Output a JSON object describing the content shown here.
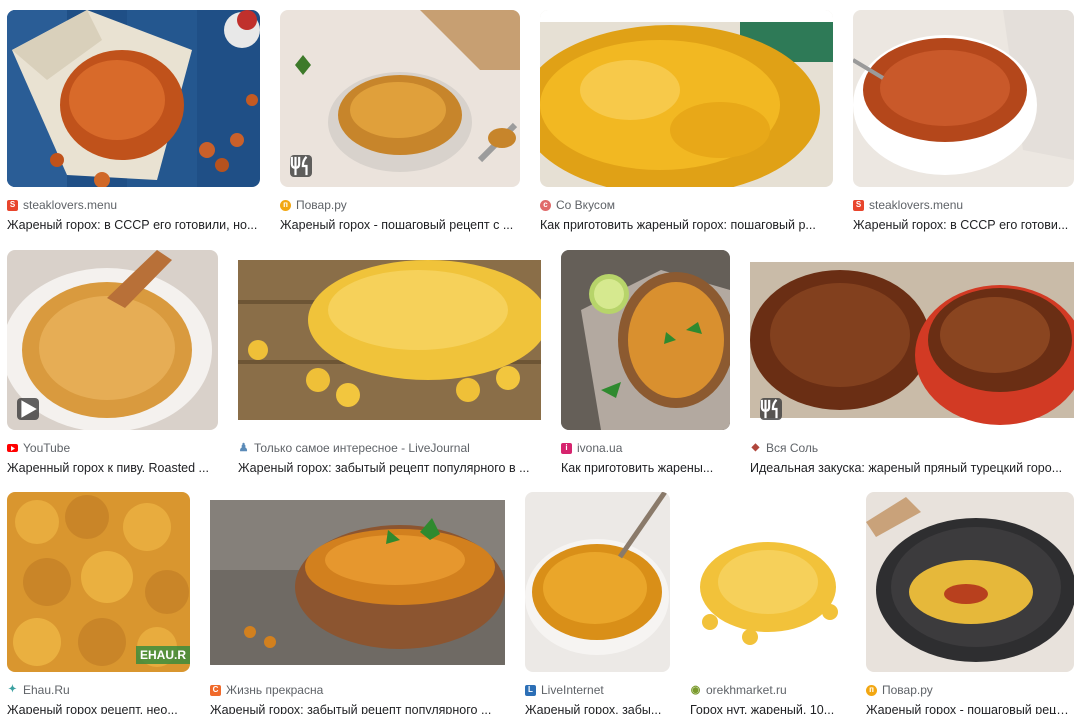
{
  "results": [
    {
      "source": "steaklovers.menu",
      "title": "Жареный горох: в СССР его готовили, но...",
      "favicon": "s-red-icon",
      "badge": "",
      "fav_color": "#e8452c"
    },
    {
      "source": "Повар.ру",
      "title": "Жареный горох - пошаговый рецепт с ...",
      "favicon": "povar-icon",
      "badge": "recipe-icon",
      "fav_color": "#f2a712"
    },
    {
      "source": "Со Вкусом",
      "title": "Как приготовить жареный горох: пошаговый р...",
      "favicon": "sovkusom-icon",
      "badge": "",
      "fav_color": "#e06b6b"
    },
    {
      "source": "steaklovers.menu",
      "title": "Жареный горох: в СССР его готови...",
      "favicon": "s-red-icon",
      "badge": "",
      "fav_color": "#e8452c"
    },
    {
      "source": "YouTube",
      "title": "Жаренный горох к пиву. Roasted ...",
      "favicon": "youtube-icon",
      "badge": "play-icon",
      "fav_color": "#ff0000"
    },
    {
      "source": "Только самое интересное - LiveJournal",
      "title": "Жареный горох: забытый рецепт популярного в ...",
      "favicon": "livejournal-icon",
      "badge": "",
      "fav_color": "#5b8bb8"
    },
    {
      "source": "ivona.ua",
      "title": "Как приготовить жарены...",
      "favicon": "ivona-icon",
      "badge": "",
      "fav_color": "#d6246e"
    },
    {
      "source": "Вся Соль",
      "title": "Идеальная закуска: жареный пряный турецкий горо...",
      "favicon": "vsyasol-icon",
      "badge": "recipe-icon",
      "fav_color": "#b0463c"
    },
    {
      "source": "Ehau.Ru",
      "title": "Жареный горох рецепт, нео...",
      "favicon": "ehau-icon",
      "badge": "",
      "fav_color": "#3aa0a0"
    },
    {
      "source": "Жизнь прекрасна",
      "title": "Жареный горох: забытый рецепт популярного ...",
      "favicon": "zhizn-icon",
      "badge": "",
      "fav_color": "#f06a2b"
    },
    {
      "source": "LiveInternet",
      "title": "Жареный горох, забы...",
      "favicon": "liveinternet-icon",
      "badge": "",
      "fav_color": "#2c6fb6"
    },
    {
      "source": "orekhmarket.ru",
      "title": "Горох нут, жареный, 10...",
      "favicon": "orekh-icon",
      "badge": "",
      "fav_color": "#7a9a2c"
    },
    {
      "source": "Повар.ру",
      "title": "Жареный горох - пошаговый рецепт с ...",
      "favicon": "povar-icon",
      "badge": "",
      "fav_color": "#f2a712"
    }
  ],
  "watermark": "EHAU.R"
}
